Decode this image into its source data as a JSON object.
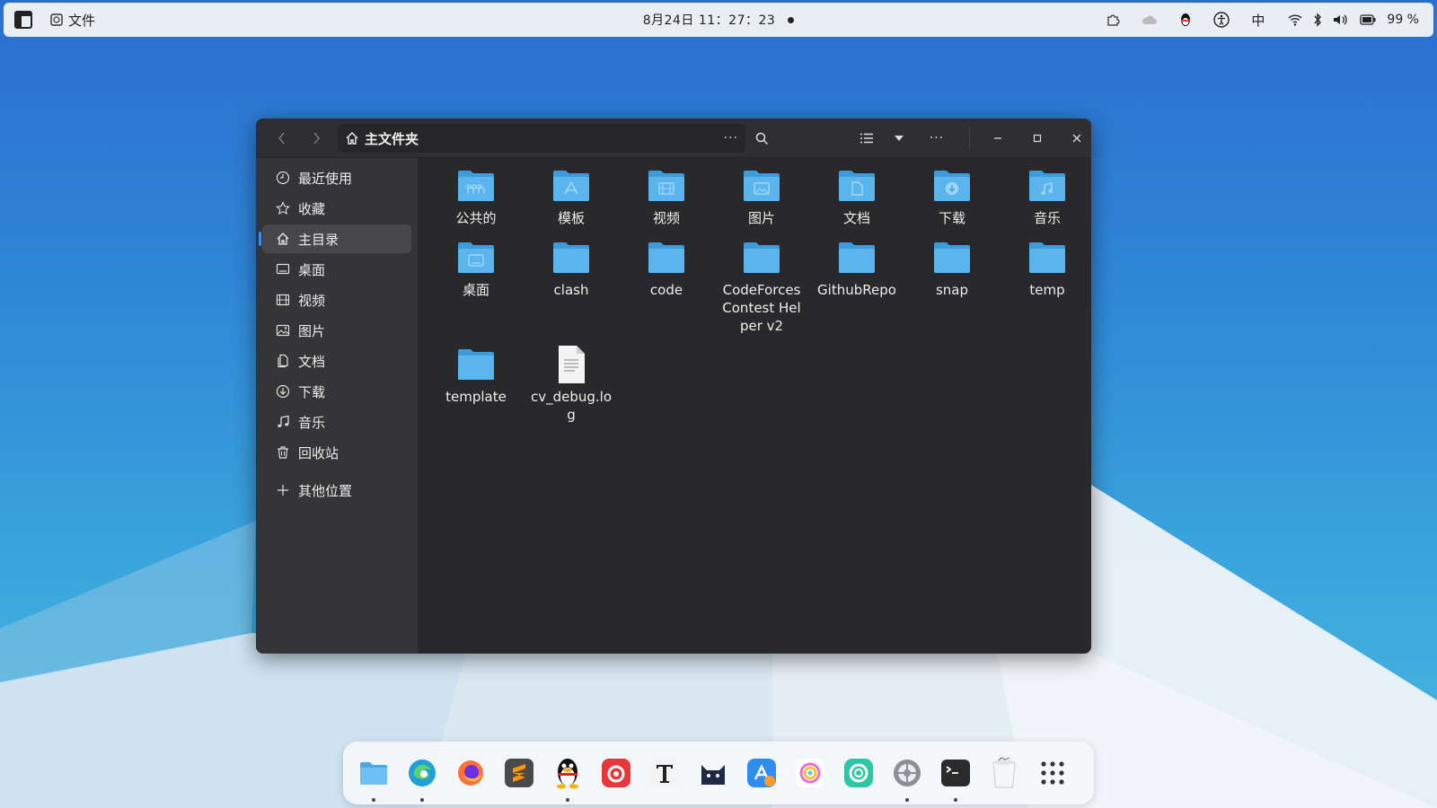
{
  "top_panel": {
    "app_name": "文件",
    "clock": "8月24日  11：27：23",
    "ime": "中",
    "battery": "99 %"
  },
  "window": {
    "path": "主文件夹"
  },
  "sidebar": {
    "items": [
      {
        "label": "最近使用",
        "icon": "clock-icon"
      },
      {
        "label": "收藏",
        "icon": "star-icon"
      },
      {
        "label": "主目录",
        "icon": "home-icon",
        "active": true
      },
      {
        "label": "桌面",
        "icon": "desktop-icon"
      },
      {
        "label": "视频",
        "icon": "video-icon"
      },
      {
        "label": "图片",
        "icon": "image-icon"
      },
      {
        "label": "文档",
        "icon": "document-icon"
      },
      {
        "label": "下载",
        "icon": "download-icon"
      },
      {
        "label": "音乐",
        "icon": "music-icon"
      },
      {
        "label": "回收站",
        "icon": "trash-icon"
      }
    ],
    "other_locations": "其他位置"
  },
  "files": [
    {
      "name": "公共的",
      "type": "folder",
      "emblem": "people"
    },
    {
      "name": "模板",
      "type": "folder",
      "emblem": "template"
    },
    {
      "name": "视频",
      "type": "folder",
      "emblem": "video"
    },
    {
      "name": "图片",
      "type": "folder",
      "emblem": "image"
    },
    {
      "name": "文档",
      "type": "folder",
      "emblem": "document"
    },
    {
      "name": "下载",
      "type": "folder",
      "emblem": "download"
    },
    {
      "name": "音乐",
      "type": "folder",
      "emblem": "music"
    },
    {
      "name": "桌面",
      "type": "folder",
      "emblem": "desktop"
    },
    {
      "name": "clash",
      "type": "folder",
      "emblem": ""
    },
    {
      "name": "code",
      "type": "folder",
      "emblem": ""
    },
    {
      "name": "CodeForces Contest Helper v2",
      "type": "folder",
      "emblem": ""
    },
    {
      "name": "GithubRepo",
      "type": "folder",
      "emblem": ""
    },
    {
      "name": "snap",
      "type": "folder",
      "emblem": ""
    },
    {
      "name": "temp",
      "type": "folder",
      "emblem": ""
    },
    {
      "name": "template",
      "type": "folder",
      "emblem": ""
    },
    {
      "name": "cv_debug.log",
      "type": "file",
      "emblem": ""
    }
  ],
  "dock": {
    "apps": [
      "files",
      "edge",
      "firefox",
      "sublime-text",
      "qq",
      "netease-music",
      "typora",
      "clash-cat",
      "app-store",
      "pinwheel",
      "remote",
      "settings",
      "terminal",
      "trash",
      "app-grid"
    ]
  },
  "colors": {
    "accent": "#3d8cf0",
    "folder": "#5bb5ec",
    "window_bg": "#29292b",
    "sidebar_bg": "#353538"
  }
}
